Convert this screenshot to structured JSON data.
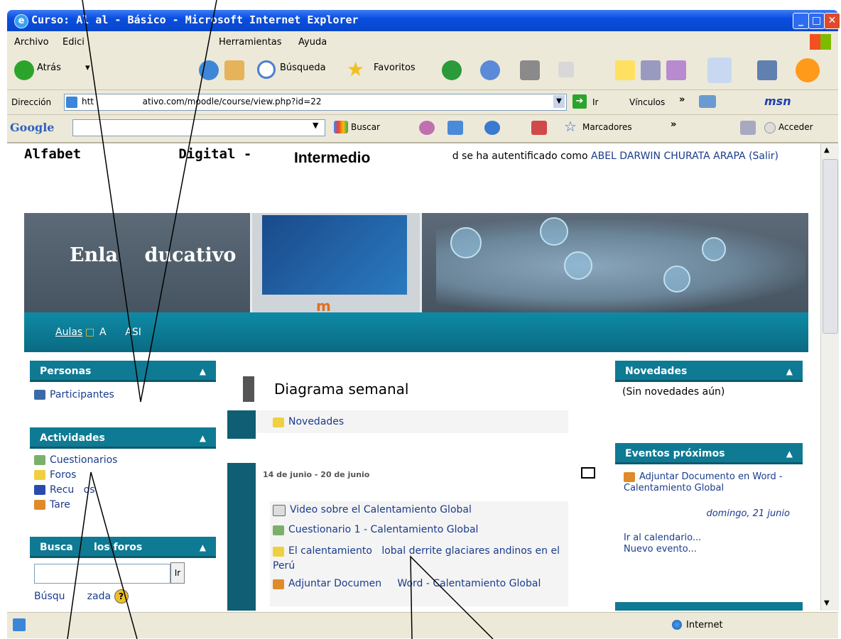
{
  "window": {
    "title": "Curso: Al              al - Básico - Microsoft Internet Explorer"
  },
  "menu": [
    "Archivo",
    "Edici",
    "Herramientas",
    "Ayuda"
  ],
  "toolbar": {
    "back": "Atrás",
    "search": "Búsqueda",
    "favorites": "Favoritos"
  },
  "address": {
    "label": "Dirección",
    "url": "htt                  ativo.com/moodle/course/view.php?id=22",
    "go": "Ir",
    "links": "Vínculos"
  },
  "googlebar": {
    "logo": "Google",
    "search": "Buscar",
    "bookmarks": "Marcadores",
    "signin": "Acceder"
  },
  "page": {
    "header_title": "Alfabet            Digital -",
    "overlay_label": "Intermedio",
    "login_text": "d se ha autentificado como",
    "user_name": "ABEL DARWIN CHURATA ARAPA",
    "logout": "(Salir)",
    "banner_title": "Enla    ducativo",
    "breadcrumb_link": "Aulas",
    "breadcrumb_sep": "□",
    "breadcrumb_current": "A      ASI"
  },
  "left": {
    "personas": {
      "title": "Personas",
      "items": [
        "Participantes"
      ]
    },
    "actividades": {
      "title": "Actividades",
      "items": [
        "Cuestionarios",
        "Foros",
        "Recu   os",
        "Tare"
      ]
    },
    "buscar": {
      "title": "Busca      los foros",
      "button": "Ir",
      "advanced": "Búsqu       zada"
    }
  },
  "center": {
    "heading": "Diagrama semanal",
    "news_link": "Novedades",
    "week_title": "14 de junio - 20 de junio",
    "activities": [
      "Video sobre el Calentamiento Global",
      "Cuestionario 1 - Calentamiento Global",
      "El calentamiento   lobal derrite glaciares andinos en el Perú",
      "Adjuntar Documen     Word - Calentamiento Global"
    ]
  },
  "right": {
    "novedades": {
      "title": "Novedades",
      "empty": "(Sin novedades aún)"
    },
    "eventos": {
      "title": "Eventos próximos",
      "event": "Adjuntar Documento en Word - Calentamiento Global",
      "date": "domingo, 21 junio",
      "calendar": "Ir al calendario...",
      "new_event": "Nuevo evento..."
    }
  },
  "status": {
    "zone": "Internet"
  },
  "colors": {
    "block_header": "#0f7a93",
    "link": "#1a3c8c",
    "xp_blue": "#0a4ee0"
  }
}
